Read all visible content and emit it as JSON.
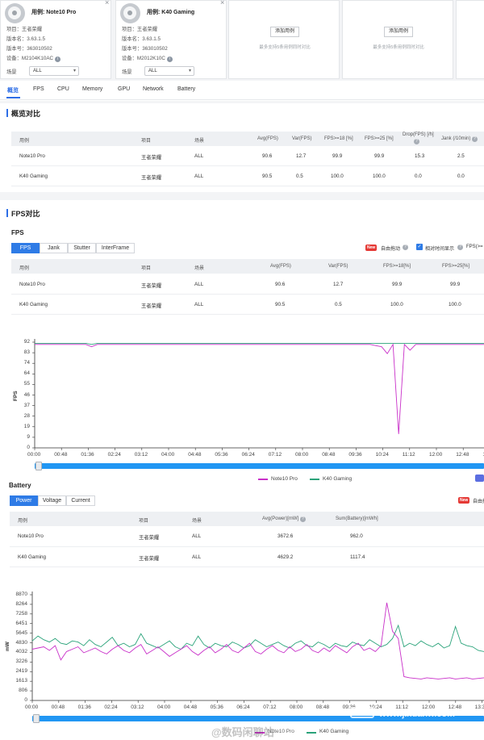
{
  "cards": [
    {
      "name": "用例: Note10 Pro",
      "project_label": "项目：",
      "project": "王者荣耀",
      "version_label": "版本名：",
      "version": "3.63.1.5",
      "version_no_label": "版本号：",
      "version_no": "363010502",
      "device_label": "设备：",
      "device": "M2104K10AC",
      "scene_label": "场景",
      "scene": "ALL"
    },
    {
      "name": "用例: K40 Gaming",
      "project_label": "项目：",
      "project": "王者荣耀",
      "version_label": "版本名：",
      "version": "3.63.1.5",
      "version_no_label": "版本号：",
      "version_no": "363010502",
      "device_label": "设备：",
      "device": "M2012K10C",
      "scene_label": "场景",
      "scene": "ALL"
    }
  ],
  "add_cards": [
    {
      "button": "添加用例",
      "hint": "最多支持5条用例同时对比"
    },
    {
      "button": "添加用例",
      "hint": "最多支持5条用例同时对比"
    }
  ],
  "tabs": [
    "概览",
    "FPS",
    "CPU",
    "Memory",
    "GPU",
    "Network",
    "Battery"
  ],
  "overview": {
    "title": "概览对比",
    "headers": [
      "用例",
      "项目",
      "场景",
      "Avg(FPS)",
      "Var(FPS)",
      "FPS>=18 [%]",
      "FPS>=25 [%]",
      "Drop(FPS) [/h]",
      "Jank (/10min)"
    ],
    "rows": [
      [
        "Note10 Pro",
        "王者荣耀",
        "ALL",
        "90.6",
        "12.7",
        "99.9",
        "99.9",
        "15.3",
        "2.5"
      ],
      [
        "K40 Gaming",
        "王者荣耀",
        "ALL",
        "90.5",
        "0.5",
        "100.0",
        "100.0",
        "0.0",
        "0.0"
      ]
    ]
  },
  "fps": {
    "section_title": "FPS对比",
    "sub_title": "FPS",
    "segments": [
      "FPS",
      "Jank",
      "Stutter",
      "InterFrame"
    ],
    "new_tag": "New",
    "auto_drag": "自由拖动",
    "relative_time": "相对时间显示",
    "fps_filter": "FPS(>=",
    "headers": [
      "用例",
      "项目",
      "场景",
      "Avg(FPS)",
      "Var(FPS)",
      "FPS>=18[%]",
      "FPS>=25[%]"
    ],
    "rows": [
      [
        "Note10 Pro",
        "王者荣耀",
        "ALL",
        "90.6",
        "12.7",
        "99.9",
        "99.9"
      ],
      [
        "K40 Gaming",
        "王者荣耀",
        "ALL",
        "90.5",
        "0.5",
        "100.0",
        "100.0"
      ]
    ],
    "legend": [
      "Note10 Pro",
      "K40 Gaming"
    ]
  },
  "battery": {
    "title": "Battery",
    "segments": [
      "Power",
      "Voltage",
      "Current"
    ],
    "new_tag": "New",
    "auto_drag": "自由拖",
    "headers": [
      "用例",
      "项目",
      "场景",
      "Avg(Power)[mW]",
      "Sum(Battery)[mWh]"
    ],
    "rows": [
      [
        "Note10 Pro",
        "王者荣耀",
        "ALL",
        "3672.6",
        "962.0"
      ],
      [
        "K40 Gaming",
        "王者荣耀",
        "ALL",
        "4629.2",
        "1117.4"
      ]
    ],
    "legend": [
      "Note10 Pro",
      "K40 Gaming"
    ]
  },
  "watermark": {
    "weibo": "@数码闲聊站",
    "site": "www.jixuanw.com"
  },
  "colors": {
    "accent": "#2e7be6",
    "note10": "#c930c9",
    "k40": "#2aa37a"
  },
  "chart_data": [
    {
      "type": "line",
      "title": "",
      "ylabel": "FPS",
      "ylim": [
        0,
        92
      ],
      "yticks": [
        "92",
        "83",
        "74",
        "64",
        "55",
        "46",
        "37",
        "28",
        "19",
        "9",
        "0"
      ],
      "xticks": [
        "00:00",
        "00:48",
        "01:36",
        "02:24",
        "03:12",
        "04:00",
        "04:48",
        "05:36",
        "06:24",
        "07:12",
        "08:00",
        "08:48",
        "09:36",
        "10:24",
        "11:12",
        "12:00",
        "12:48",
        "13:36"
      ],
      "series": [
        {
          "name": "Note10 Pro",
          "values": [
            90,
            90,
            90,
            90,
            90,
            90,
            90,
            90,
            90,
            90,
            88,
            90,
            90,
            90,
            90,
            90,
            90,
            90,
            90,
            90,
            90,
            90,
            90,
            90,
            90,
            90,
            90,
            90,
            90,
            90,
            90,
            90,
            90,
            90,
            90,
            90,
            90,
            90,
            90,
            90,
            90,
            90,
            90,
            90,
            90,
            90,
            90,
            90,
            90,
            90,
            90,
            90,
            90,
            90,
            90,
            90,
            90,
            90,
            90,
            90,
            89,
            88,
            82,
            90,
            12,
            90,
            85,
            90,
            90,
            90,
            90,
            90,
            90,
            90,
            90,
            90,
            90,
            90,
            90,
            90
          ]
        },
        {
          "name": "K40 Gaming",
          "values": [
            91,
            91,
            91,
            91,
            91,
            91,
            91,
            91,
            91,
            91,
            90,
            91,
            91,
            91,
            91,
            91,
            91,
            91,
            91,
            91,
            91,
            91,
            91,
            91,
            91,
            91,
            91,
            91,
            91,
            91,
            91,
            91,
            91,
            91,
            91,
            91,
            91,
            91,
            91,
            91,
            91,
            91,
            91,
            91,
            91,
            91,
            91,
            91,
            91,
            91,
            91,
            91,
            91,
            91,
            91,
            91,
            91,
            91,
            91,
            91,
            91,
            91,
            91,
            91,
            91,
            91,
            91,
            91,
            91,
            91,
            91,
            91,
            91,
            91,
            91,
            91,
            91,
            91,
            91,
            91
          ]
        }
      ]
    },
    {
      "type": "line",
      "title": "",
      "ylabel": "mW",
      "ylim": [
        0,
        8870
      ],
      "yticks": [
        "8870",
        "8264",
        "7258",
        "6451",
        "5645",
        "4830",
        "4032",
        "3226",
        "2419",
        "1613",
        "806",
        "0"
      ],
      "xticks": [
        "00:00",
        "00:48",
        "01:36",
        "02:24",
        "03:12",
        "04:00",
        "04:48",
        "05:36",
        "06:24",
        "07:12",
        "08:00",
        "08:48",
        "09:36",
        "10:24",
        "11:12",
        "12:00",
        "12:48",
        "13:36"
      ],
      "series": [
        {
          "name": "Note10 Pro",
          "values": [
            4300,
            4400,
            4500,
            4200,
            4600,
            3400,
            4100,
            4300,
            4500,
            4000,
            4200,
            4400,
            4100,
            3900,
            4300,
            4600,
            4200,
            4000,
            4400,
            4700,
            3900,
            4200,
            4500,
            4100,
            3700,
            4000,
            4300,
            4600,
            4100,
            3800,
            4200,
            4500,
            4000,
            4300,
            4700,
            4200,
            4000,
            4400,
            4800,
            4100,
            3900,
            4300,
            4600,
            4200,
            4000,
            4500,
            4100,
            4300,
            4700,
            4200,
            4000,
            4400,
            4100,
            4600,
            4300,
            4000,
            4500,
            4800,
            4200,
            4400,
            4100,
            4600,
            8200,
            5800,
            5200,
            2000,
            1900,
            1850,
            1800,
            1900,
            1850,
            1800,
            1850,
            1900,
            1800,
            1850,
            1900,
            1800,
            1850,
            1900
          ]
        },
        {
          "name": "K40 Gaming",
          "values": [
            5000,
            5400,
            5100,
            4900,
            5200,
            4800,
            4700,
            5000,
            4900,
            4600,
            5100,
            4700,
            4500,
            4900,
            5300,
            4600,
            4800,
            4500,
            4700,
            5600,
            4800,
            4600,
            4400,
            4700,
            5000,
            4500,
            4300,
            4800,
            4600,
            5400,
            4700,
            4400,
            4800,
            4600,
            4500,
            4900,
            4700,
            4400,
            4600,
            5100,
            4800,
            4500,
            4700,
            4900,
            4600,
            4400,
            4800,
            5000,
            4600,
            4500,
            4900,
            4700,
            4400,
            4800,
            4600,
            4500,
            4900,
            4700,
            4600,
            5100,
            4800,
            4500,
            4700,
            5200,
            6300,
            4500,
            4800,
            4600,
            5000,
            4700,
            4500,
            4800,
            4400,
            4600,
            6200,
            4800,
            4600,
            4500,
            4200,
            4100
          ]
        }
      ]
    }
  ]
}
